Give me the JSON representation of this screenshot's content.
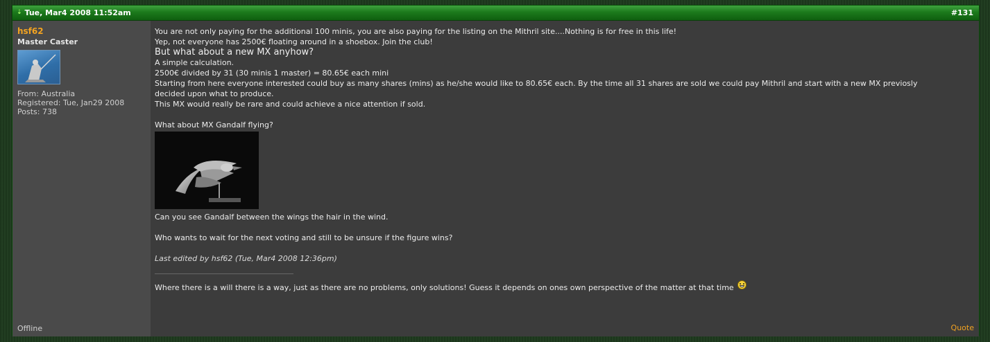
{
  "post": {
    "date": "Tue, Mar4 2008 11:52am",
    "number": "#131",
    "author": {
      "username": "hsf62",
      "rank": "Master Caster",
      "from": "From: Australia",
      "registered": "Registered: Tue, Jan29 2008",
      "posts": "Posts: 738",
      "status": "Offline"
    },
    "body": {
      "line1": "You are not only paying for the additional 100 minis, you are also paying for the listing on the Mithril site....Nothing is for free in this life!",
      "line2": "Yep, not everyone has 2500€ floating around in a shoebox. Join the club!",
      "heading": "But what about a new MX anyhow?",
      "calc_title": "A simple calculation.",
      "calc_line": "2500€ divided by 31 (30 minis 1 master) = 80.65€ each mini",
      "shares_line1": "Starting from here everyone interested could buy as many shares (mins) as he/she would like to 80.65€ each. By the time all 31 shares are sold we could pay Mithril and start with a new MX previosly",
      "shares_line2": "decided upon what to produce.",
      "rare_line": "This MX would really be rare and could achieve a nice attention if sold.",
      "gandalf_q": "What about MX Gandalf flying?",
      "wings_line": "Can you see Gandalf between the wings the hair in the wind.",
      "voting_line": "Who wants to wait for the next voting and still to be unsure if the figure wins?",
      "edit_note": "Last edited by hsf62 (Tue, Mar4 2008 12:36pm)",
      "signature": "Where there is a will there is a way, just as there are no problems, only solutions! Guess it depends on ones own perspective of the matter at that time"
    },
    "quote_label": "Quote"
  },
  "icons": {
    "header_arrow": "down-arrow-icon",
    "signature_emoticon": "grin-smiley-icon"
  },
  "colors": {
    "header_green": "#1c7a1c",
    "username_orange": "#f2a321",
    "author_panel": "#4a4a4a",
    "content_panel": "#3c3c3c"
  }
}
